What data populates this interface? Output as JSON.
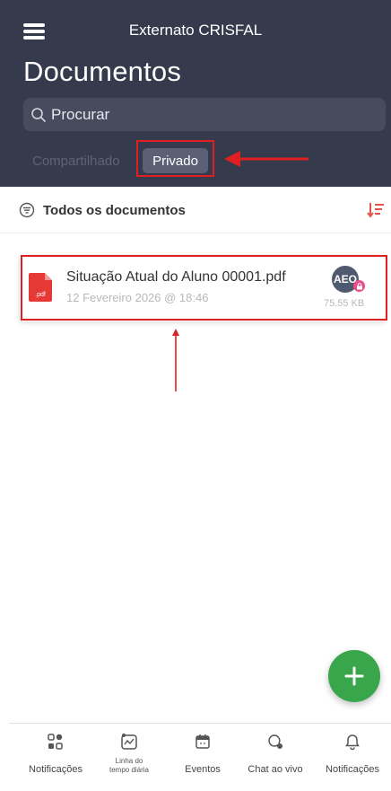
{
  "header": {
    "app_title": "Externato CRISFAL",
    "page_title": "Documentos",
    "search_placeholder": "Procurar",
    "tabs": [
      {
        "label": "Compartilhado",
        "active": false
      },
      {
        "label": "Privado",
        "active": true
      }
    ],
    "background_color": "#363a4d"
  },
  "filter": {
    "label": "Todos os documentos"
  },
  "documents": [
    {
      "name": "Situação Atual do Aluno 00001.pdf",
      "date": "12 Fevereiro 2026 @ 18:46",
      "file_icon_label": ".pdf",
      "avatar_initials": "AEO",
      "size": "75.55 KB",
      "locked": true
    }
  ],
  "fab": {
    "icon": "plus-icon",
    "color": "#3aa64c"
  },
  "bottom_nav": [
    {
      "label": "Notificações",
      "icon": "grid-icon"
    },
    {
      "label": "Linha do\ntempo diária",
      "icon": "timeline-icon"
    },
    {
      "label": "Eventos",
      "icon": "calendar-icon"
    },
    {
      "label": "Chat ao vivo",
      "icon": "chat-icon"
    },
    {
      "label": "Notificações",
      "icon": "bell-icon"
    }
  ],
  "annotation_color": "#e02020"
}
